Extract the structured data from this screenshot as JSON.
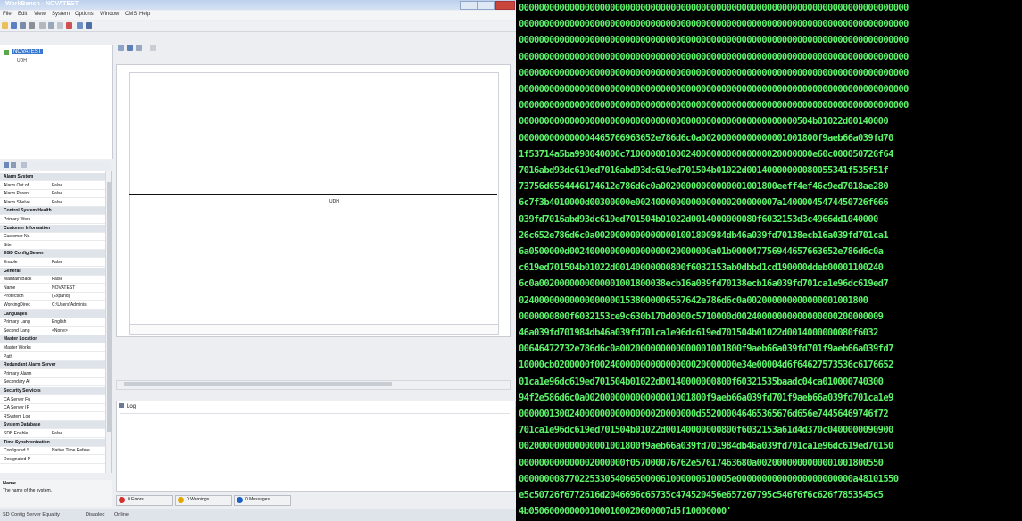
{
  "app": {
    "window_title": "WorkBench - NOVATEST",
    "menu": [
      "File",
      "Edit",
      "View",
      "System",
      "Options",
      "Window",
      "CMS",
      "Help"
    ],
    "tree": {
      "root_label": "NOVATEST",
      "child_label": "UDH"
    },
    "property_grid": {
      "rows": [
        {
          "type": "cat",
          "key": "Alarm System"
        },
        {
          "type": "row",
          "key": "Alarm Out of",
          "value": "False"
        },
        {
          "type": "row",
          "key": "Alarm Parent",
          "value": "False"
        },
        {
          "type": "row",
          "key": "Alarm Shelve",
          "value": "False"
        },
        {
          "type": "cat",
          "key": "Control System Health"
        },
        {
          "type": "row",
          "key": "Primary Work",
          "value": ""
        },
        {
          "type": "cat",
          "key": "Customer Information"
        },
        {
          "type": "row",
          "key": "Customer Na",
          "value": ""
        },
        {
          "type": "row",
          "key": "Site",
          "value": ""
        },
        {
          "type": "cat",
          "key": "EGD Config Server"
        },
        {
          "type": "row",
          "key": "Enable",
          "value": "False"
        },
        {
          "type": "cat",
          "key": "General"
        },
        {
          "type": "row",
          "key": "Maintain Back",
          "value": "False"
        },
        {
          "type": "row",
          "key": "Name",
          "value": "NOVATEST"
        },
        {
          "type": "row",
          "key": "Protection",
          "value": "(Expand)"
        },
        {
          "type": "row",
          "key": "WorkingDirec",
          "value": "C:\\Users\\Adminis"
        },
        {
          "type": "cat",
          "key": "Languages"
        },
        {
          "type": "row",
          "key": "Primary Lang",
          "value": "English"
        },
        {
          "type": "row",
          "key": "Second Lang",
          "value": "<None>"
        },
        {
          "type": "cat",
          "key": "Master Location"
        },
        {
          "type": "row",
          "key": "Master Works",
          "value": ""
        },
        {
          "type": "row",
          "key": "Path",
          "value": ""
        },
        {
          "type": "cat",
          "key": "Redundant Alarm Server"
        },
        {
          "type": "row",
          "key": "Primary Alarm",
          "value": ""
        },
        {
          "type": "row",
          "key": "Secondary Al",
          "value": ""
        },
        {
          "type": "cat",
          "key": "Security Services"
        },
        {
          "type": "row",
          "key": "CA Server Fu",
          "value": ""
        },
        {
          "type": "row",
          "key": "CA Server IP",
          "value": ""
        },
        {
          "type": "row",
          "key": "RSystem Log",
          "value": ""
        },
        {
          "type": "cat",
          "key": "System Database"
        },
        {
          "type": "row",
          "key": "SDB Enable",
          "value": "False"
        },
        {
          "type": "cat",
          "key": "Time Synchronization"
        },
        {
          "type": "row",
          "key": "Configured S",
          "value": "Native Time Refere"
        },
        {
          "type": "row",
          "key": "Designated P",
          "value": ""
        }
      ]
    },
    "description": {
      "title": "Name",
      "text": "The name of the system."
    },
    "diagram": {
      "bus_label": "UDH"
    },
    "log": {
      "tab_label": "Log",
      "buttons": [
        {
          "label": "0 Errors",
          "color": "#d32f2f"
        },
        {
          "label": "0 Warnings",
          "color": "#e0a800"
        },
        {
          "label": "0 Messages",
          "color": "#1f5fbf"
        }
      ]
    },
    "status_bar": {
      "left": "SD Config Server Equality",
      "mid1": "Disabled",
      "mid2": "Online"
    }
  },
  "hex": {
    "color": "#5cf26a",
    "lines": [
      "00000000000000000000000000000000000000000000000000000000000000000000000000000",
      "00000000000000000000000000000000000000000000000000000000000000000000000000000",
      "00000000000000000000000000000000000000000000000000000000000000000000000000000",
      "00000000000000000000000000000000000000000000000000000000000000000000000000000",
      "00000000000000000000000000000000000000000000000000000000000000000000000000000",
      "00000000000000000000000000000000000000000000000000000000000000000000000000000",
      "00000000000000000000000000000000000000000000000000000000000000000000000000000",
      "0000000000000000000000000000000000000000000000000000000504b01022d00140000",
      "000000000000004465766963652e786d6c0a00200000000000001001800f9aeb66a039fd70",
      "1f53714a5ba998040000c7100000010002400000000000000020000000e60c000050726f64",
      "7016abd93dc619ed7016abd93dc619ed701504b01022d00140000000080055341f535f51f",
      "73756d6564446174612e786d6c0a00200000000000001001800eeff4ef46c9ed7018ae280",
      "6c7f3b4010000d00300000e0024000000000000000200000007a14000045474450726f666",
      "039fd7016abd93dc619ed701504b01022d0014000000080f6032153d3c4966dd1040000",
      "26c652e786d6c0a00200000000000001001800984db46a039fd70138ecb16a039fd701ca1",
      "6a0500000d0024000000000000000020000000a01b000047756944657663652e786d6c0a",
      "c619ed701504b01022d00140000000800f6032153ab0dbbd1cd190000ddeb00001100240",
      "6c0a0020000000000001001800038ecb16a039fd70138ecb16a039fd701ca1e96dc619ed7",
      "024000000000000000001538000006567642e786d6c0a002000000000000001001800",
      "0000000800f6032153ce9c630b170d0000c5710000d00240000000000000000200000009",
      "46a039fd701984db46a039fd701ca1e96dc619ed701504b01022d0014000000080f6032",
      "00646472732e786d6c0a002000000000000001001800f9aeb66a039fd701f9aeb66a039fd7",
      "10000cb0200000f0024000000000000000020000000e34e00004d6f64627573536c6176652",
      "01ca1e96dc619ed701504b01022d00140000000800f60321535baadc04ca010000740300",
      "94f2e586d6c0a002000000000000001001800f9aeb66a039fd701f9aeb66a039fd701ca1e9",
      "00000013002400000000000000020000000d552000046465365676d656e74456469746f72",
      "701ca1e96dc619ed701504b01022d00140000000800f6032153a61d4d370c0400000090900",
      "002000000000000001001800f9aeb66a039fd701984db46a039fd701ca1e96dc619ed70150",
      "000000000000002000000f057000076762e57617463680a0020000000000001001800550",
      "000000008770225330540665000061000000610005e00000000000000000000000a48101550",
      "e5c50726f6772616d2046696c65735c474520456e657267795c546f6f6c626f7853545c5",
      "4b0506000000001000100020600007d5f10000000'"
    ]
  }
}
